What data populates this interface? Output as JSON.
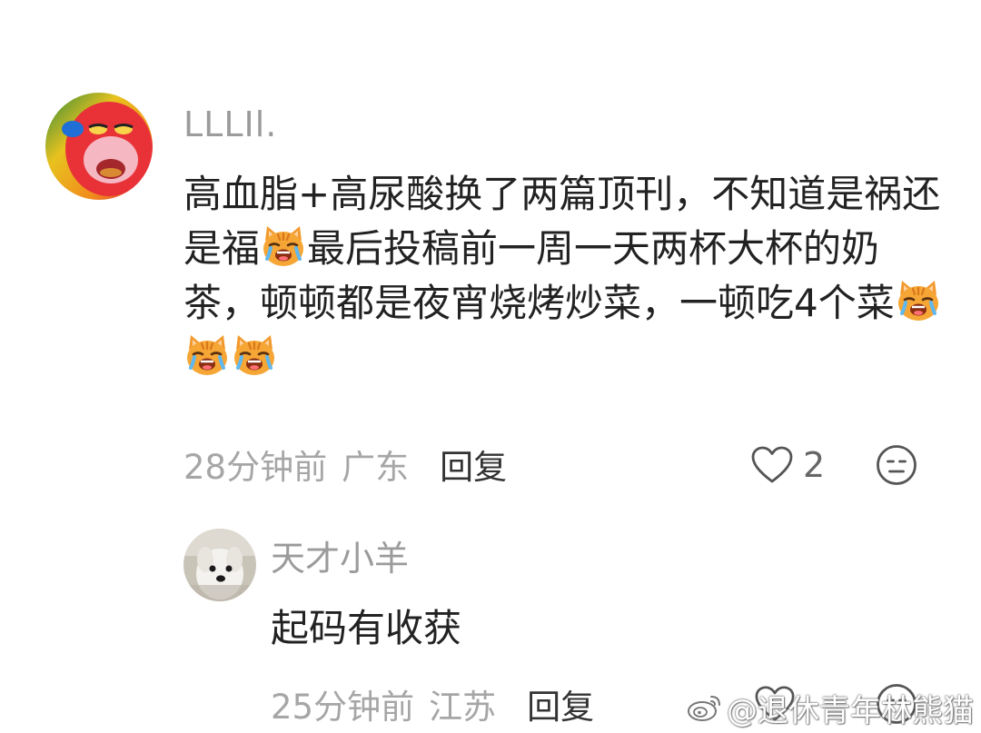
{
  "comment": {
    "username": "LLLIl.",
    "text_1": "高血脂+高尿酸换了两篇顶刊，不知道是祸还是福",
    "text_2": "最后投稿前一周一天两杯大杯的奶茶，顿顿都是夜宵烧烤炒菜，一顿吃4个菜",
    "time": "28分钟前",
    "location": "广东",
    "reply_label": "回复",
    "like_count": "2",
    "emoji_icon": "crying-cat-emoji"
  },
  "reply": {
    "username": "天才小羊",
    "text": "起码有收获",
    "time": "25分钟前",
    "location": "江苏",
    "reply_label": "回复"
  },
  "watermark": {
    "text": "@退休青年林熊猫",
    "platform_icon": "weibo-logo"
  }
}
